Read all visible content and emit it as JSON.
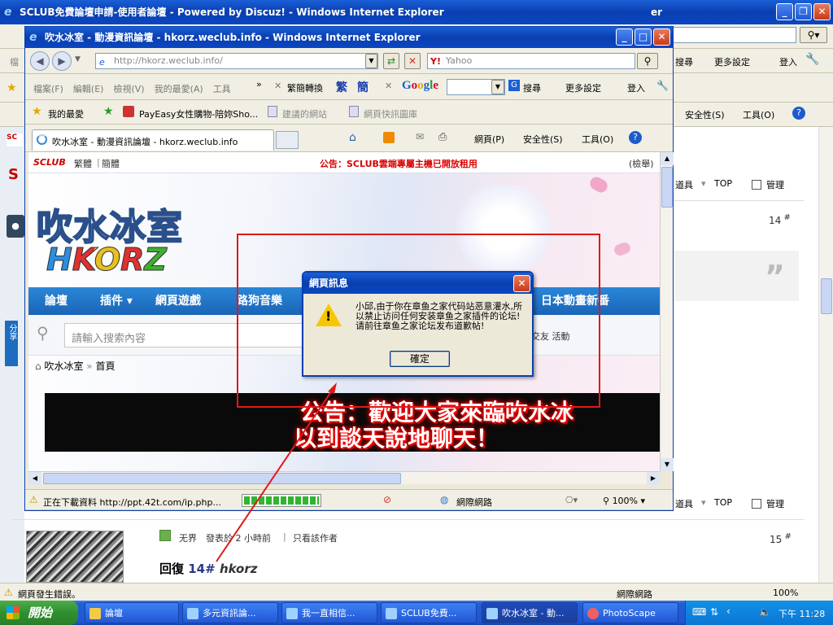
{
  "back_window": {
    "title": "SCLUB免費論壇申請-使用者論壇 - Powered by Discuz! - Windows Internet Explorer",
    "menu_partial": "檔",
    "search_btn_label": "搜尋",
    "more_settings_label": "更多設定",
    "login_label": "登入",
    "safety_label": "安全性(S)",
    "tools_label": "工具(O)",
    "title_right_partial": "er",
    "post_row_1": {
      "tools": "道具",
      "top": "TOP",
      "manage": "管理",
      "floor": "14"
    },
    "post_row_2": {
      "tools": "道具",
      "top": "TOP",
      "manage": "管理",
      "floor": "15"
    },
    "author_name": "无界",
    "post_time": "發表於 2 小時前",
    "view_author_only": "只看該作者",
    "reply_prefix": "回復",
    "reply_floor": "14#",
    "reply_user": "hkorz",
    "share_label": "分享",
    "status_error": "網頁發生錯誤。",
    "status_zone": "網際網路",
    "status_zoom": "100%"
  },
  "front_window": {
    "title": "吹水冰室 - 動漫資訊論壇 - hkorz.weclub.info - Windows Internet Explorer",
    "address_url": "http://hkorz.weclub.info/",
    "search_placeholder": "Yahoo",
    "menu": [
      "檔案(F)",
      "編輯(E)",
      "檢視(V)",
      "我的最愛(A)",
      "工具"
    ],
    "convert_label": "繁簡轉換",
    "trad_label": "繁",
    "simp_label": "簡",
    "google_search_label": "搜尋",
    "more_settings_label": "更多設定",
    "login_label": "登入",
    "favorites_label": "我的最愛",
    "fav_links": [
      "PayEasy女性購物-陪妳Sho...",
      "建議的網站",
      "網頁快訊圖庫"
    ],
    "tab_title": "吹水冰室 - 動漫資訊論壇 - hkorz.weclub.info",
    "cmd_page": "網頁(P)",
    "cmd_safety": "安全性(S)",
    "cmd_tools": "工具(O)",
    "status_text": "正在下載資料 http://ppt.42t.com/ip.php...",
    "status_zone": "網際網路",
    "status_zoom": "100%"
  },
  "forum": {
    "sclub_logo": "SCLUB",
    "lang_trad": "繁體",
    "lang_simp": "簡體",
    "announcement": "公告：SCLUB雲端專屬主機已開放租用",
    "report_label": "(檢舉)",
    "logo_cn": "吹水冰室",
    "logo_en": "HKORZ",
    "nav": [
      "論壇",
      "插件",
      "網頁遊戲",
      "路狗音樂",
      "日本動畫新番"
    ],
    "search_placeholder": "請輸入搜索內容",
    "quick_links": "交友  活動",
    "breadcrumb_home": "吹水冰室",
    "breadcrumb_current": "首頁",
    "banner_line1": "公告：歡迎大家來臨吹水冰",
    "banner_line2": "以到談天說地聊天！"
  },
  "dialog": {
    "title": "網頁訊息",
    "message": "小邱,由于你在章鱼之家代码站恶意灌水,所以禁止访问任何安装章鱼之家插件的论坛!请前往章鱼之家论坛发布道歉帖!",
    "ok_label": "確定"
  },
  "taskbar": {
    "start_label": "開始",
    "items": [
      "論壇",
      "多元資訊論...",
      "我一直相信...",
      "SCLUB免費...",
      "吹水冰室 - 動...",
      "PhotoScape"
    ],
    "clock": "下午 11:28"
  },
  "colors": {
    "xp_title_blue": "#0a3fb0",
    "nav_blue": "#1e6fc0",
    "annotation_red": "#e01818",
    "dialog_icon_yellow": "#f7c600"
  }
}
